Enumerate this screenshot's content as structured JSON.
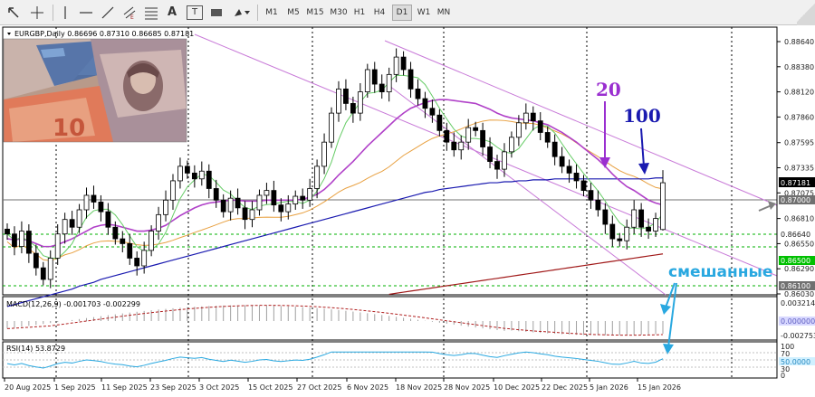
{
  "toolbar": {
    "icons": [
      "window-icon",
      "crosshair-icon",
      "vertical-line-icon",
      "horizontal-line-icon",
      "trendline-icon",
      "equidistant-channel-icon",
      "fibonacci-icon",
      "text-icon",
      "text-label-icon",
      "rectangle-icon",
      "shapes-dropdown-icon"
    ],
    "glyphs": {
      "text": "A",
      "text_label": "T"
    },
    "timeframes": [
      "M1",
      "M5",
      "M15",
      "M30",
      "H1",
      "H4",
      "D1",
      "W1",
      "MN"
    ],
    "active_timeframe": "D1"
  },
  "chart_header": {
    "symbol_line": "EURGBP,Daily  0.86696 0.87310 0.86685 0.87181"
  },
  "annotations": {
    "label_20": "20",
    "label_100": "100",
    "label_mixed": "смешанные",
    "color_20": "#9a2fd0",
    "color_100": "#1a1ab0",
    "color_mixed": "#29a8e0"
  },
  "price_axis": {
    "ticks": [
      "0.88640",
      "0.88380",
      "0.88120",
      "0.87860",
      "0.87595",
      "0.87335",
      "0.87075",
      "0.86810",
      "0.86550",
      "0.86290",
      "0.86030"
    ],
    "current_price": "0.87181",
    "badges": [
      "0.87000",
      "0.86640",
      "0.86500",
      "0.86100"
    ]
  },
  "macd": {
    "label": "MACD(12,26,9) -0.001703 -0.002299",
    "ticks": [
      "0.003214",
      "0.000000",
      "-0.002753"
    ]
  },
  "rsi": {
    "label": "RSI(14) 53.8729",
    "ticks": [
      "100",
      "70",
      "50.0000",
      "30",
      "0"
    ]
  },
  "date_axis": [
    "20 Aug 2025",
    "1 Sep 2025",
    "11 Sep 2025",
    "23 Sep 2025",
    "3 Oct 2025",
    "15 Oct 2025",
    "27 Oct 2025",
    "6 Nov 2025",
    "18 Nov 2025",
    "28 Nov 2025",
    "10 Dec 2025",
    "22 Dec 2025",
    "5 Jan 2026",
    "15 Jan 2026"
  ],
  "chart_data": {
    "type": "candlestick",
    "symbol": "EURGBP",
    "timeframe": "Daily",
    "ohlc_current": {
      "open": 0.86696,
      "high": 0.8731,
      "low": 0.86685,
      "close": 0.87181
    },
    "y_range": [
      0.8603,
      0.8864
    ],
    "close_series": [
      0.8665,
      0.8652,
      0.8668,
      0.8645,
      0.863,
      0.8618,
      0.864,
      0.8665,
      0.868,
      0.8672,
      0.869,
      0.8705,
      0.8698,
      0.8688,
      0.8672,
      0.866,
      0.8655,
      0.864,
      0.8632,
      0.8648,
      0.8668,
      0.8685,
      0.87,
      0.872,
      0.8735,
      0.8728,
      0.8722,
      0.873,
      0.8712,
      0.87,
      0.8688,
      0.8702,
      0.8692,
      0.868,
      0.869,
      0.8705,
      0.871,
      0.8695,
      0.8688,
      0.8696,
      0.8704,
      0.87,
      0.8712,
      0.8735,
      0.876,
      0.879,
      0.8815,
      0.88,
      0.879,
      0.8812,
      0.8835,
      0.882,
      0.8812,
      0.883,
      0.8848,
      0.8835,
      0.8815,
      0.8805,
      0.8795,
      0.8788,
      0.8772,
      0.876,
      0.8752,
      0.876,
      0.8775,
      0.8772,
      0.8755,
      0.874,
      0.8732,
      0.875,
      0.8765,
      0.878,
      0.879,
      0.8782,
      0.877,
      0.876,
      0.8745,
      0.8735,
      0.8728,
      0.872,
      0.871,
      0.87,
      0.869,
      0.8675,
      0.866,
      0.8658,
      0.8672,
      0.869,
      0.8672,
      0.8668,
      0.8681,
      0.8718
    ],
    "ma20": [
      0.866,
      0.8659,
      0.866,
      0.8658,
      0.8655,
      0.8652,
      0.8652,
      0.8654,
      0.8657,
      0.866,
      0.8664,
      0.8668,
      0.8672,
      0.8674,
      0.8675,
      0.8674,
      0.8672,
      0.867,
      0.8668,
      0.8668,
      0.8669,
      0.8671,
      0.8674,
      0.8679,
      0.8684,
      0.8688,
      0.8692,
      0.8695,
      0.8697,
      0.8698,
      0.8699,
      0.87,
      0.87,
      0.8699,
      0.8699,
      0.8699,
      0.87,
      0.87,
      0.87,
      0.87,
      0.87,
      0.8701,
      0.8703,
      0.8706,
      0.8711,
      0.8718,
      0.8726,
      0.8733,
      0.874,
      0.8748,
      0.8756,
      0.8763,
      0.877,
      0.8777,
      0.8784,
      0.879,
      0.8795,
      0.8798,
      0.8801,
      0.8803,
      0.8804,
      0.8804,
      0.8803,
      0.8802,
      0.8801,
      0.88,
      0.8797,
      0.8794,
      0.879,
      0.8787,
      0.8785,
      0.8784,
      0.8783,
      0.8782,
      0.878,
      0.8778,
      0.8774,
      0.877,
      0.8765,
      0.876,
      0.8754,
      0.8748,
      0.8742,
      0.8735,
      0.8727,
      0.872,
      0.8714,
      0.871,
      0.8705,
      0.87,
      0.8697,
      0.8695
    ],
    "ma100": [
      0.859,
      0.8592,
      0.8594,
      0.8596,
      0.8598,
      0.86,
      0.8602,
      0.8604,
      0.8606,
      0.8608,
      0.8611,
      0.8613,
      0.8615,
      0.8618,
      0.862,
      0.8622,
      0.8624,
      0.8626,
      0.8628,
      0.863,
      0.8632,
      0.8634,
      0.8636,
      0.8638,
      0.864,
      0.8642,
      0.8644,
      0.8646,
      0.8648,
      0.865,
      0.8652,
      0.8654,
      0.8656,
      0.8658,
      0.866,
      0.8662,
      0.8664,
      0.8666,
      0.8668,
      0.867,
      0.8672,
      0.8674,
      0.8676,
      0.8678,
      0.868,
      0.8682,
      0.8684,
      0.8686,
      0.8688,
      0.869,
      0.8692,
      0.8694,
      0.8696,
      0.8698,
      0.87,
      0.8702,
      0.8704,
      0.8706,
      0.8708,
      0.8709,
      0.8711,
      0.8712,
      0.8713,
      0.8714,
      0.8715,
      0.8716,
      0.8717,
      0.8718,
      0.8718,
      0.8719,
      0.8719,
      0.872,
      0.872,
      0.8721,
      0.8721,
      0.8721,
      0.8722,
      0.8722,
      0.8722,
      0.8722,
      0.8722,
      0.8722,
      0.8722,
      0.8722,
      0.8722,
      0.8722,
      0.8722,
      0.8722,
      0.8722,
      0.8722,
      0.8723,
      0.8723
    ],
    "series": [
      {
        "name": "20",
        "color": "#b040c8"
      },
      {
        "name": "100",
        "color": "#1a1ab0"
      }
    ]
  }
}
